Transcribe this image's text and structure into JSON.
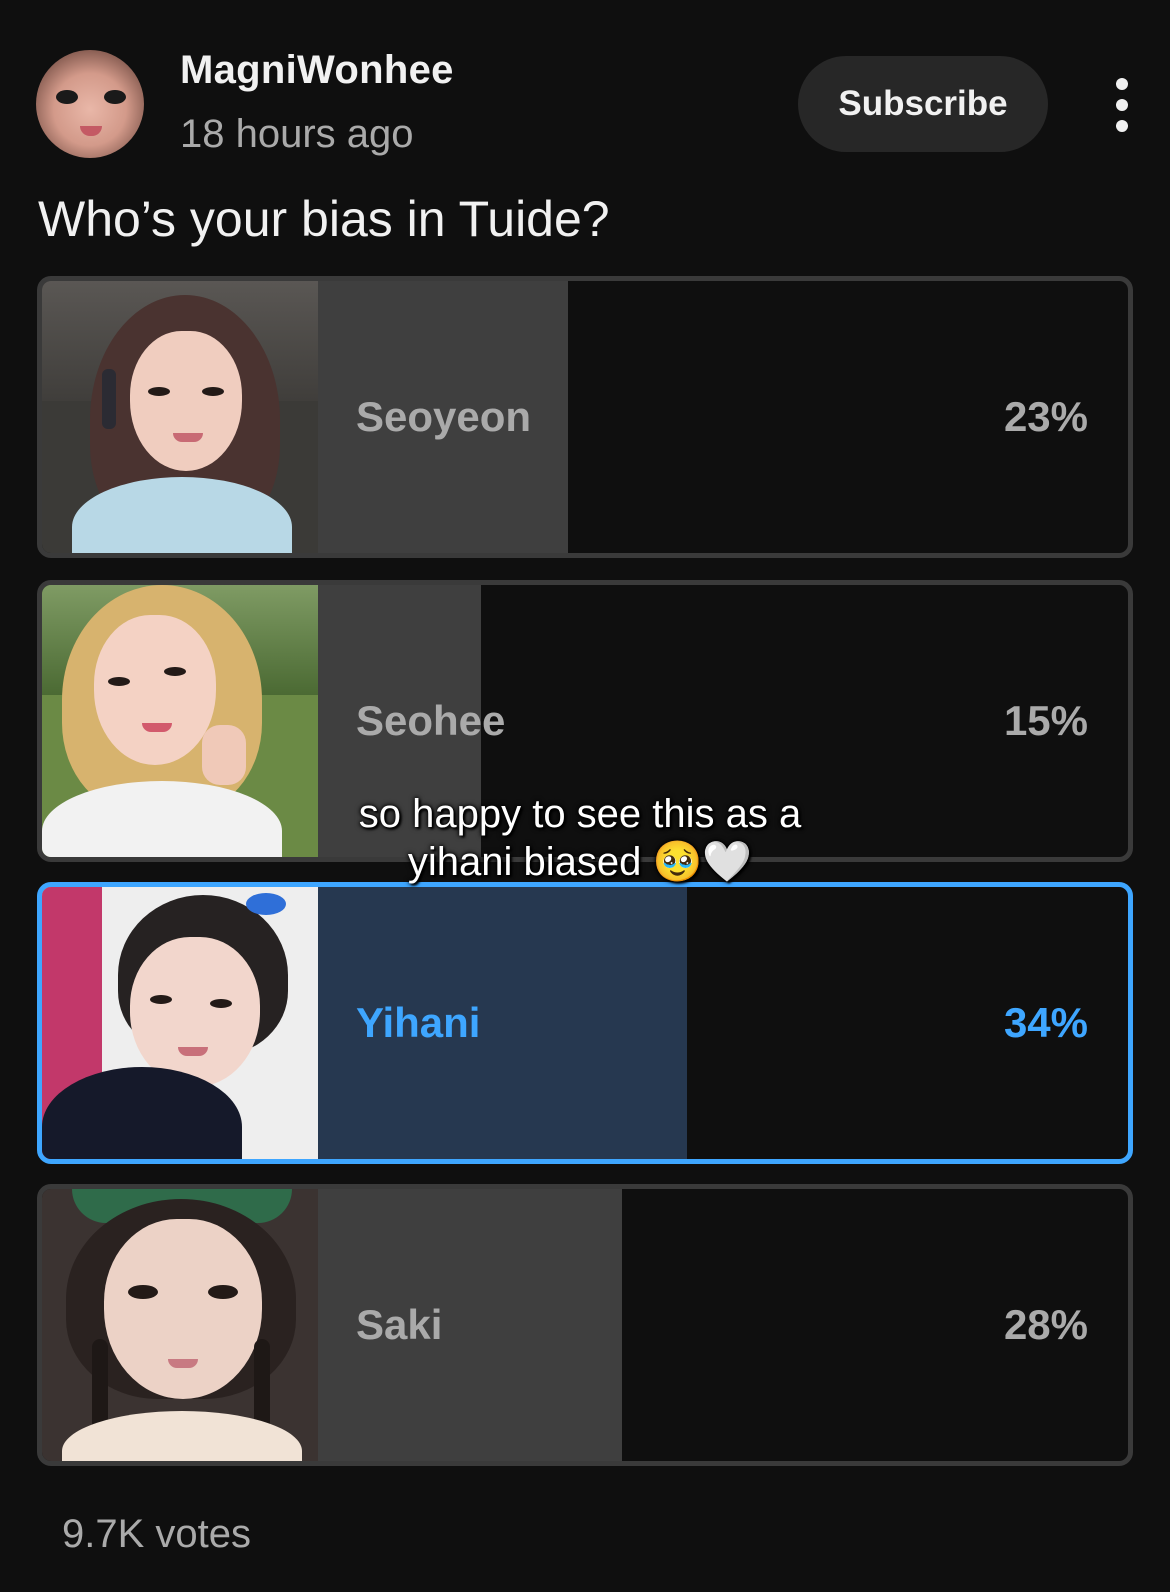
{
  "post": {
    "channel_name": "MagniWonhee",
    "timestamp": "18 hours ago",
    "subscribe_label": "Subscribe",
    "question": "Who’s your bias in Tuide?",
    "votes": "9.7K votes"
  },
  "poll": {
    "options": [
      {
        "label": "Seoyeon",
        "percent": "23%",
        "fraction": 0.23,
        "selected": false
      },
      {
        "label": "Seohee",
        "percent": "15%",
        "fraction": 0.15,
        "selected": false
      },
      {
        "label": "Yihani",
        "percent": "34%",
        "fraction": 0.34,
        "selected": true
      },
      {
        "label": "Saki",
        "percent": "28%",
        "fraction": 0.28,
        "selected": false
      }
    ]
  },
  "overlay": {
    "caption_line1": "so happy to see this as a",
    "caption_line2": "yihani biased 🥹🤍"
  },
  "colors": {
    "background": "#0f0f0f",
    "selected_accent": "#3ea6ff",
    "selected_fill": "#263850",
    "unselected_fill": "#3f3f3f"
  },
  "icons": {
    "more": "more-vertical-icon"
  }
}
